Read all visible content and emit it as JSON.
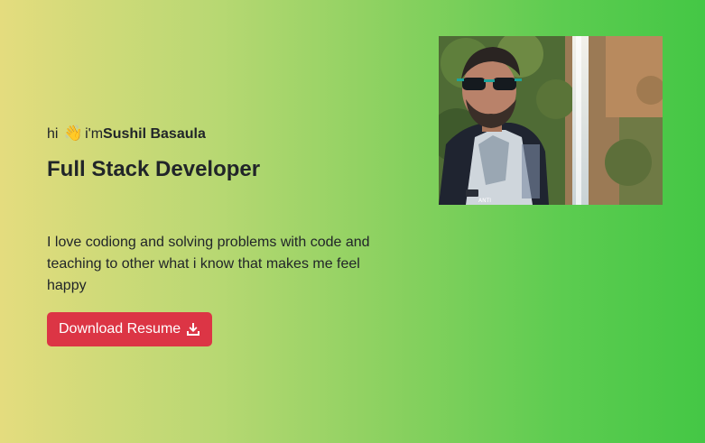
{
  "hero": {
    "greeting_prefix": "hi",
    "wave_emoji": "👋",
    "greeting_im": "i'm",
    "name": "Sushil Basaula",
    "role": "Full Stack Developer",
    "bio": "I love codiong and solving problems with code and teaching to other what i know that makes me feel happy",
    "resume_button": "Download Resume",
    "resume_icon": "download-icon"
  },
  "photo": {
    "alt": "profile photo",
    "shirt_badge": "ANTI"
  },
  "colors": {
    "gradient_start": "#e4dc7e",
    "gradient_end": "#44c745",
    "button": "#dc3545",
    "button_text": "#ffffff",
    "text": "#212529"
  }
}
